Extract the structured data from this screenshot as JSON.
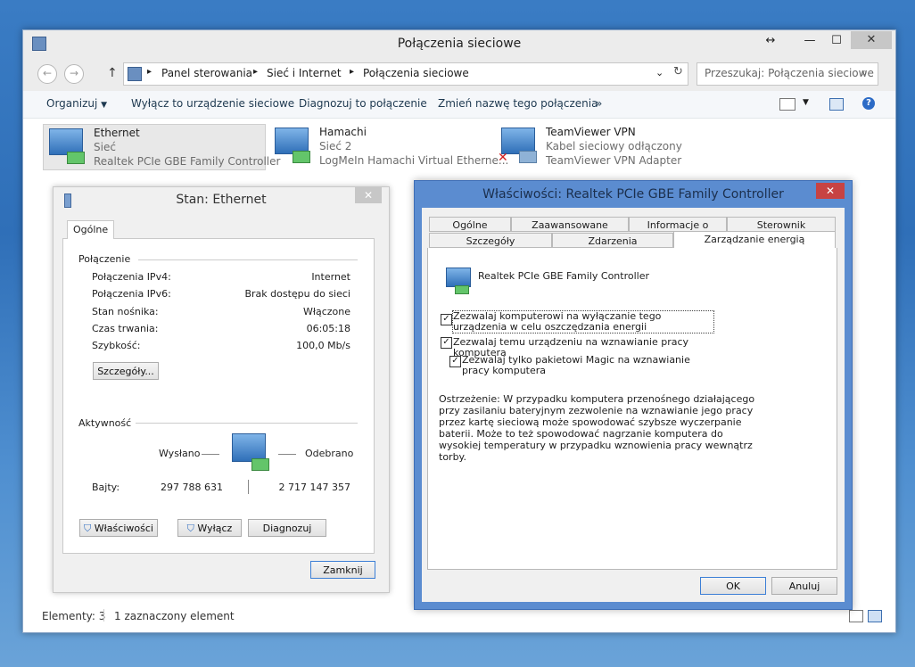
{
  "explorer": {
    "title": "Połączenia sieciowe",
    "breadcrumb": [
      "Panel sterowania",
      "Sieć i Internet",
      "Połączenia sieciowe"
    ],
    "search_placeholder": "Przeszukaj: Połączenia sieciowe",
    "toolbar": {
      "organize": "Organizuj",
      "disable": "Wyłącz to urządzenie sieciowe",
      "diagnose": "Diagnozuj to połączenie",
      "rename": "Zmień nazwę tego połączenia",
      "more": "»"
    },
    "items": [
      {
        "name": "Ethernet",
        "status": "Sieć",
        "device": "Realtek PCIe GBE Family Controller"
      },
      {
        "name": "Hamachi",
        "status": "Sieć  2",
        "device": "LogMeIn Hamachi Virtual Etherne..."
      },
      {
        "name": "TeamViewer VPN",
        "status": "Kabel sieciowy odłączony",
        "device": "TeamViewer VPN Adapter"
      }
    ],
    "statusbar": {
      "count": "Elementy: 3",
      "selected": "1 zaznaczony element"
    }
  },
  "stan": {
    "title": "Stan: Ethernet",
    "tab": "Ogólne",
    "section_connection": "Połączenie",
    "rows": [
      {
        "label": "Połączenia IPv4:",
        "value": "Internet"
      },
      {
        "label": "Połączenia IPv6:",
        "value": "Brak dostępu do sieci"
      },
      {
        "label": "Stan nośnika:",
        "value": "Włączone"
      },
      {
        "label": "Czas trwania:",
        "value": "06:05:18"
      },
      {
        "label": "Szybkość:",
        "value": "100,0 Mb/s"
      }
    ],
    "details_button": "Szczegóły...",
    "section_activity": "Aktywność",
    "sent_label": "Wysłano",
    "received_label": "Odebrano",
    "bytes_label": "Bajty:",
    "bytes_sent": "297 788 631",
    "bytes_received": "2 717 147 357",
    "btn_properties": "Właściwości",
    "btn_disable": "Wyłącz",
    "btn_diagnose": "Diagnozuj",
    "btn_close": "Zamknij"
  },
  "props": {
    "title": "Właściwości: Realtek PCIe GBE Family Controller",
    "tabs_row1": [
      "Ogólne",
      "Zaawansowane",
      "Informacje o",
      "Sterownik"
    ],
    "tabs_row2": [
      "Szczegóły",
      "Zdarzenia",
      "Zarządzanie energią"
    ],
    "device_name": "Realtek PCIe GBE Family Controller",
    "checkboxes": [
      {
        "label": "Zezwalaj komputerowi na wyłączanie tego urządzenia w celu oszczędzania energii",
        "checked": true
      },
      {
        "label": "Zezwalaj temu urządzeniu na wznawianie pracy komputera",
        "checked": true
      },
      {
        "label": "Zezwalaj tylko pakietowi Magic na wznawianie pracy komputera",
        "checked": true
      }
    ],
    "warning": "Ostrzeżenie: W przypadku komputera przenośnego działającego przy zasilaniu bateryjnym zezwolenie na wznawianie jego pracy przez kartę sieciową może spowodować szybsze wyczerpanie baterii. Może to też spowodować nagrzanie komputera do wysokiej temperatury w przypadku wznowienia pracy wewnątrz torby.",
    "ok": "OK",
    "cancel": "Anuluj"
  }
}
